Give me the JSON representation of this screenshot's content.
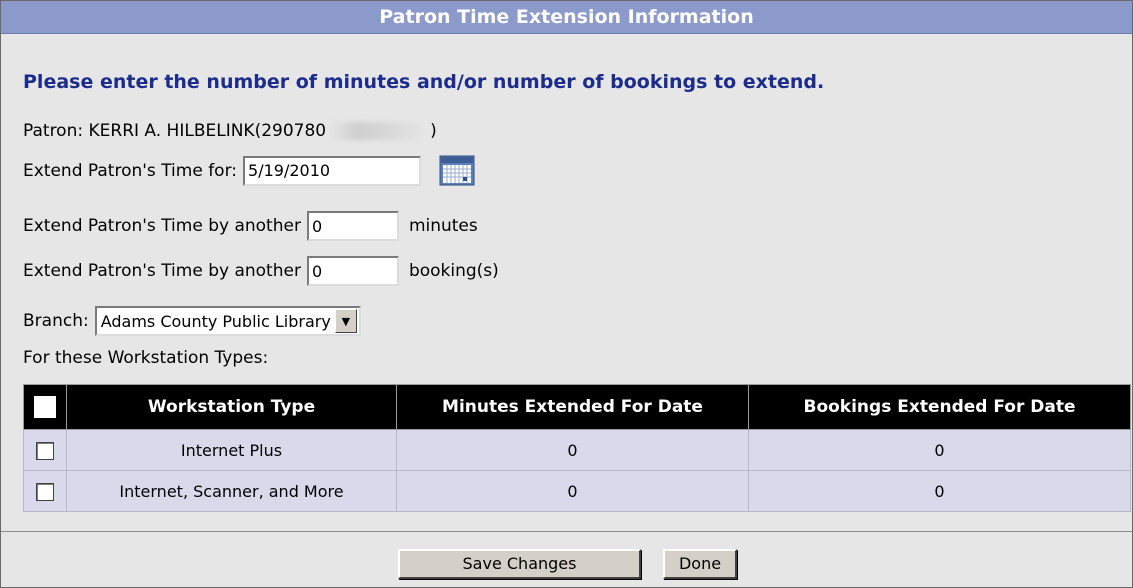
{
  "title": "Patron Time Extension Information",
  "instruction": "Please enter the number of minutes and/or number of bookings to extend.",
  "patron": {
    "prefix": "Patron: KERRI A. HILBELINK(290780",
    "suffix": ")"
  },
  "extend_date": {
    "label": "Extend Patron's Time for:",
    "value": "5/19/2010",
    "calendar_icon": "calendar-icon"
  },
  "extend_minutes": {
    "label": "Extend Patron's Time by another",
    "value": "0",
    "unit": "minutes"
  },
  "extend_bookings": {
    "label": "Extend Patron's Time by another",
    "value": "0",
    "unit": "booking(s)"
  },
  "branch": {
    "label": "Branch:",
    "selected": "Adams County Public Library"
  },
  "workstation_types_label": "For these Workstation Types:",
  "table": {
    "columns": [
      "Workstation Type",
      "Minutes Extended For Date",
      "Bookings Extended For Date"
    ],
    "rows": [
      {
        "type": "Internet Plus",
        "minutes": "0",
        "bookings": "0"
      },
      {
        "type": "Internet, Scanner, and More",
        "minutes": "0",
        "bookings": "0"
      }
    ]
  },
  "buttons": {
    "save": "Save Changes",
    "done": "Done"
  },
  "colors": {
    "titlebar": "#8c9acb",
    "instruction": "#1c2c8c",
    "row_bg": "#d8daec",
    "header_bg": "#000000"
  }
}
